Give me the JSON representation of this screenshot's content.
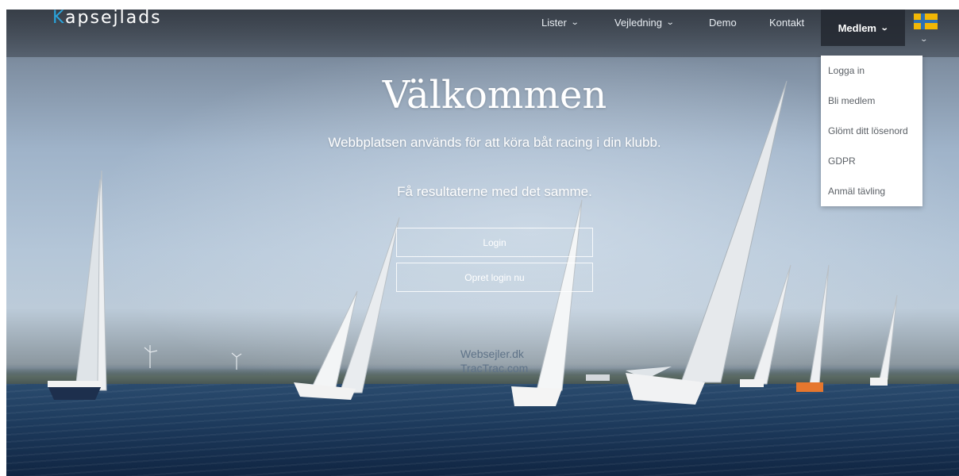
{
  "brand": {
    "first_letter": "K",
    "rest": "apsejlads"
  },
  "nav": {
    "items": [
      {
        "label": "Lister",
        "has_dropdown": true
      },
      {
        "label": "Vejledning",
        "has_dropdown": true
      },
      {
        "label": "Demo",
        "has_dropdown": false
      },
      {
        "label": "Kontakt",
        "has_dropdown": false
      },
      {
        "label": "Medlem",
        "has_dropdown": true,
        "active": true
      }
    ],
    "language_flag": "swedish-flag-icon",
    "chevron_icon": "chevron-down-icon"
  },
  "member_menu": {
    "items": [
      "Logga in",
      "Bli medlem",
      "Glömt ditt lösenord",
      "GDPR",
      "Anmäl tävling"
    ]
  },
  "hero": {
    "title": "Välkommen",
    "subtitle": "Webbplatsen används för att köra båt racing i din klubb.",
    "tagline": "Få resultaterne med det samme.",
    "login_button": "Login",
    "signup_button": "Opret login nu",
    "credit_1": "Websejler.dk",
    "credit_2": "TracTrac.com"
  },
  "colors": {
    "brand_accent": "#2aa4dc",
    "nav_active_bg": "#23282f",
    "flag_yellow": "#f2b705",
    "flag_blue": "#2d6fb3"
  }
}
